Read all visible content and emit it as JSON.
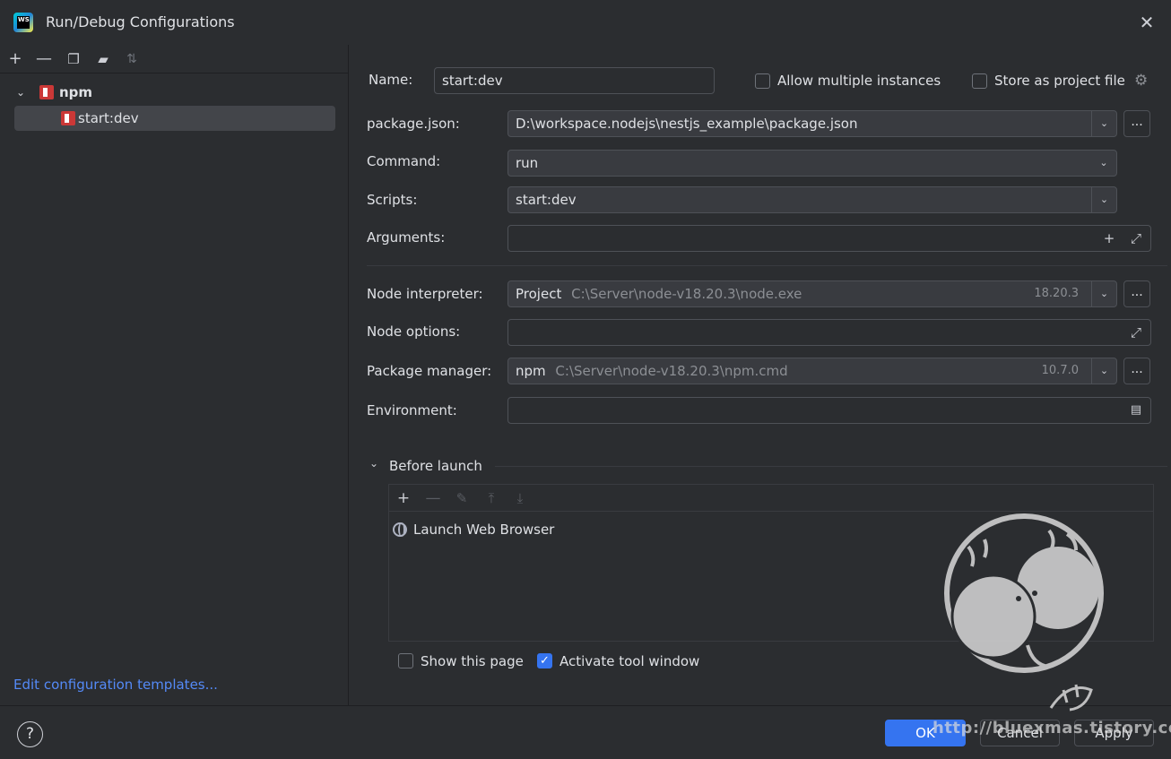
{
  "window": {
    "title": "Run/Debug Configurations",
    "logo_text": "WS"
  },
  "sidebar": {
    "tree": [
      {
        "label": "npm",
        "expanded": true
      },
      {
        "label": "start:dev",
        "selected": true
      }
    ],
    "templates_link": "Edit configuration templates..."
  },
  "form": {
    "name_label": "Name:",
    "name_value": "start:dev",
    "allow_multiple_label": "Allow multiple instances",
    "store_as_project_label": "Store as project file",
    "package_json_label": "package.json:",
    "package_json_value": "D:\\workspace.nodejs\\nestjs_example\\package.json",
    "command_label": "Command:",
    "command_value": "run",
    "scripts_label": "Scripts:",
    "scripts_value": "start:dev",
    "arguments_label": "Arguments:",
    "arguments_value": "",
    "node_interpreter_label": "Node interpreter:",
    "node_interpreter_name": "Project",
    "node_interpreter_path": "C:\\Server\\node-v18.20.3\\node.exe",
    "node_interpreter_version": "18.20.3",
    "node_options_label": "Node options:",
    "node_options_value": "",
    "package_manager_label": "Package manager:",
    "package_manager_name": "npm",
    "package_manager_path": "C:\\Server\\node-v18.20.3\\npm.cmd",
    "package_manager_version": "10.7.0",
    "environment_label": "Environment:",
    "environment_value": "",
    "browse_label": "..."
  },
  "before_launch": {
    "title": "Before launch",
    "items": [
      "Launch Web Browser"
    ],
    "show_this_page_label": "Show this page",
    "show_this_page_checked": false,
    "activate_tool_window_label": "Activate tool window",
    "activate_tool_window_checked": true
  },
  "footer": {
    "help_label": "?",
    "ok_label": "OK",
    "cancel_label": "Cancel",
    "apply_label": "Apply"
  },
  "watermark": {
    "text": "http://bluexmas.tistory.com/"
  },
  "colors": {
    "background": "#2b2d30",
    "accent": "#3574f0",
    "link": "#548af7",
    "npm": "#cb3837"
  }
}
